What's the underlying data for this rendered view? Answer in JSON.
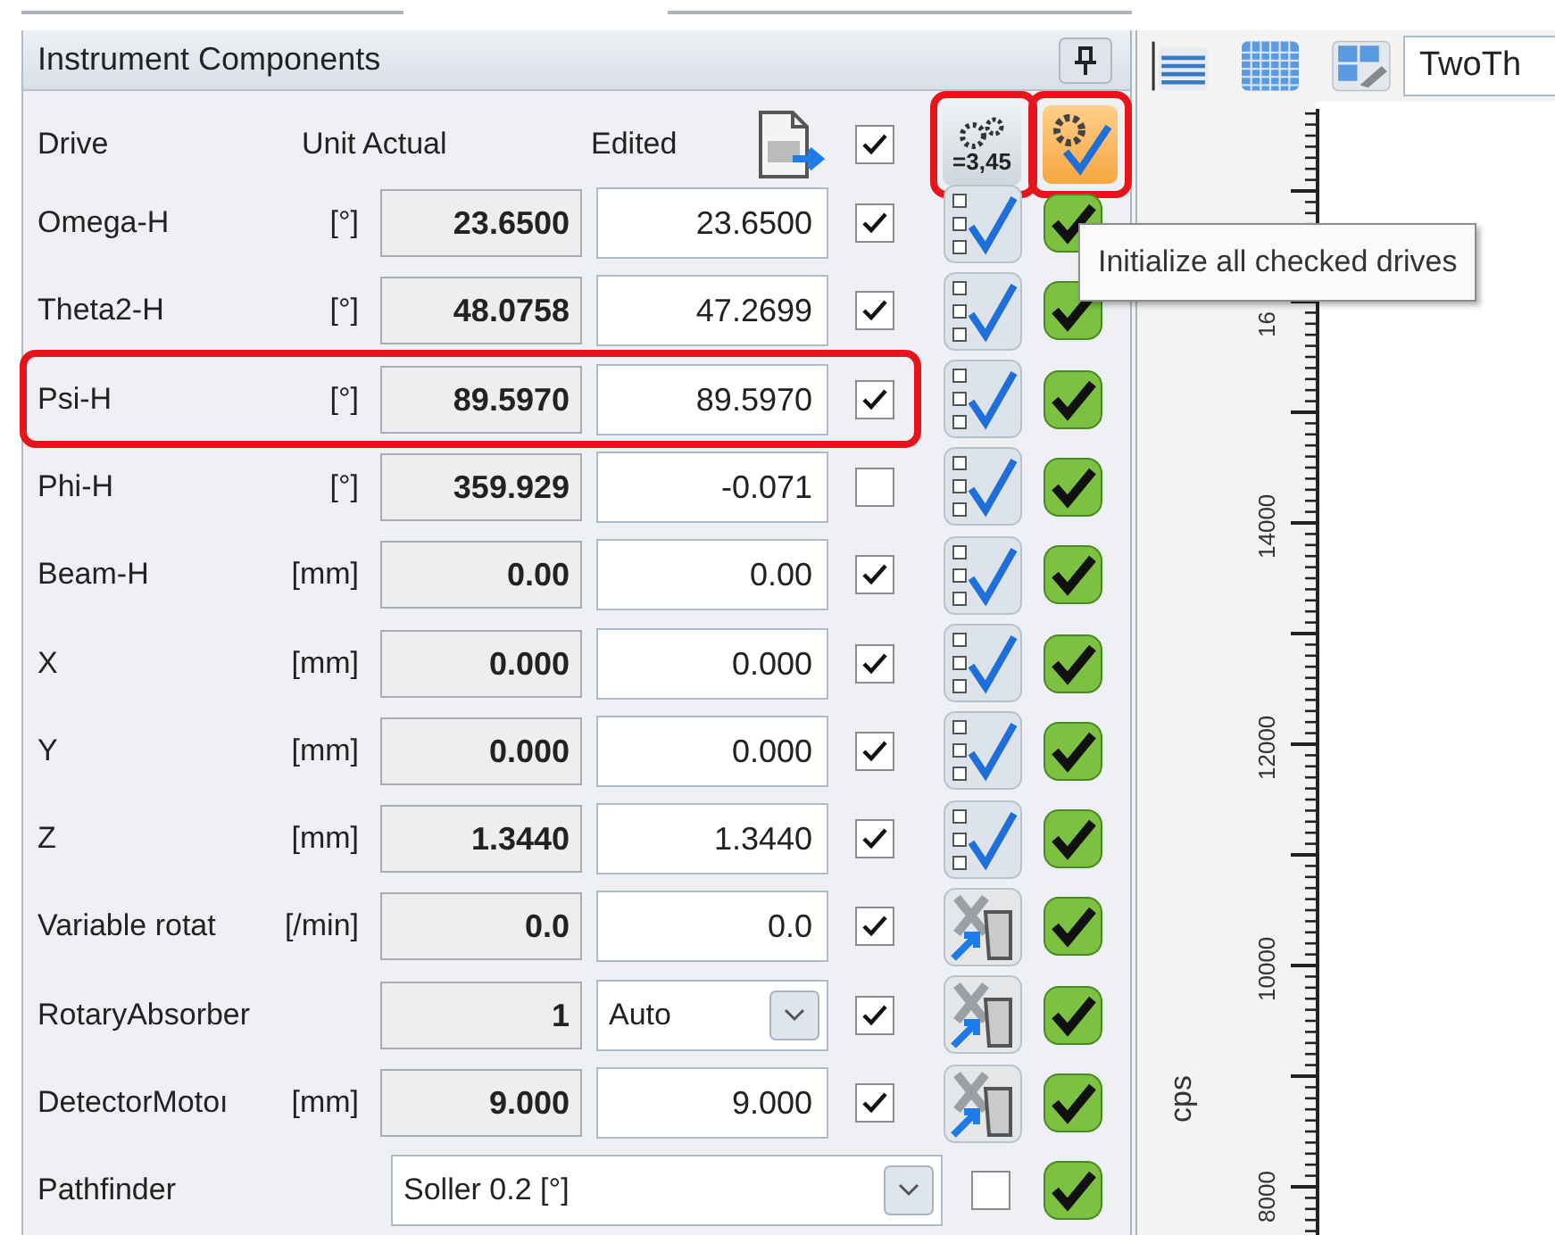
{
  "panel": {
    "title": "Instrument Components"
  },
  "header": {
    "drive": "Drive",
    "unit_actual": "Unit Actual",
    "edited": "Edited",
    "all_checked": true
  },
  "toolbar_buttons": [
    {
      "kind": "calculate",
      "label": "=3,45",
      "highlighted": true
    },
    {
      "kind": "initialize",
      "highlighted": true
    }
  ],
  "tooltip": "Initialize all checked drives",
  "rows": [
    {
      "kind": "numeric",
      "name": "Omega-H",
      "unit": "[°]",
      "actual": "23.6500",
      "edited": "23.6500",
      "checked": true,
      "action": {
        "kind": "select"
      },
      "status": {
        "kind": "ok"
      },
      "highlighted": false
    },
    {
      "kind": "numeric",
      "name": "Theta2-H",
      "unit": "[°]",
      "actual": "48.0758",
      "edited": "47.2699",
      "checked": true,
      "action": {
        "kind": "select"
      },
      "status": {
        "kind": "ok"
      },
      "highlighted": false
    },
    {
      "kind": "numeric",
      "name": "Psi-H",
      "unit": "[°]",
      "actual": "89.5970",
      "edited": "89.5970",
      "checked": true,
      "action": {
        "kind": "select"
      },
      "status": {
        "kind": "ok"
      },
      "highlighted": true
    },
    {
      "kind": "numeric",
      "name": "Phi-H",
      "unit": "[°]",
      "actual": "359.929",
      "edited": "-0.071",
      "checked": false,
      "action": {
        "kind": "select"
      },
      "status": {
        "kind": "ok"
      },
      "highlighted": false
    },
    {
      "kind": "numeric",
      "name": "Beam-H",
      "unit": "[mm]",
      "actual": "0.00",
      "edited": "0.00",
      "checked": true,
      "action": {
        "kind": "select"
      },
      "status": {
        "kind": "ok"
      },
      "highlighted": false
    },
    {
      "kind": "numeric",
      "name": "X",
      "unit": "[mm]",
      "actual": "0.000",
      "edited": "0.000",
      "checked": true,
      "action": {
        "kind": "select"
      },
      "status": {
        "kind": "ok"
      },
      "highlighted": false
    },
    {
      "kind": "numeric",
      "name": "Y",
      "unit": "[mm]",
      "actual": "0.000",
      "edited": "0.000",
      "checked": true,
      "action": {
        "kind": "select"
      },
      "status": {
        "kind": "ok"
      },
      "highlighted": false
    },
    {
      "kind": "numeric",
      "name": "Z",
      "unit": "[mm]",
      "actual": "1.3440",
      "edited": "1.3440",
      "checked": true,
      "action": {
        "kind": "select"
      },
      "status": {
        "kind": "ok"
      },
      "highlighted": false
    },
    {
      "kind": "numeric",
      "name": "Variable rotat",
      "unit": "[/min]",
      "actual": "0.0",
      "edited": "0.0",
      "checked": true,
      "action": {
        "kind": "axis"
      },
      "status": {
        "kind": "ok"
      },
      "highlighted": false
    },
    {
      "kind": "dropdown",
      "name": "RotaryAbsorber",
      "actual": "1",
      "edited": "Auto",
      "checked": true,
      "action": {
        "kind": "axis"
      },
      "status": {
        "kind": "ok"
      },
      "highlighted": false
    },
    {
      "kind": "numeric",
      "name": "DetectorMotoı",
      "unit": "[mm]",
      "actual": "9.000",
      "edited": "9.000",
      "checked": true,
      "action": {
        "kind": "axis"
      },
      "status": {
        "kind": "ok"
      },
      "highlighted": false
    },
    {
      "kind": "selector",
      "name": "Pathfinder",
      "value": "Soller 0.2 [°]",
      "checked": false,
      "status": {
        "kind": "ok"
      },
      "highlighted": false
    }
  ],
  "chart": {
    "toolbar_field": "TwoTh",
    "ylabel": "cps",
    "tick_labels": [
      "16",
      "14000",
      "12000",
      "10000",
      "8000"
    ]
  }
}
